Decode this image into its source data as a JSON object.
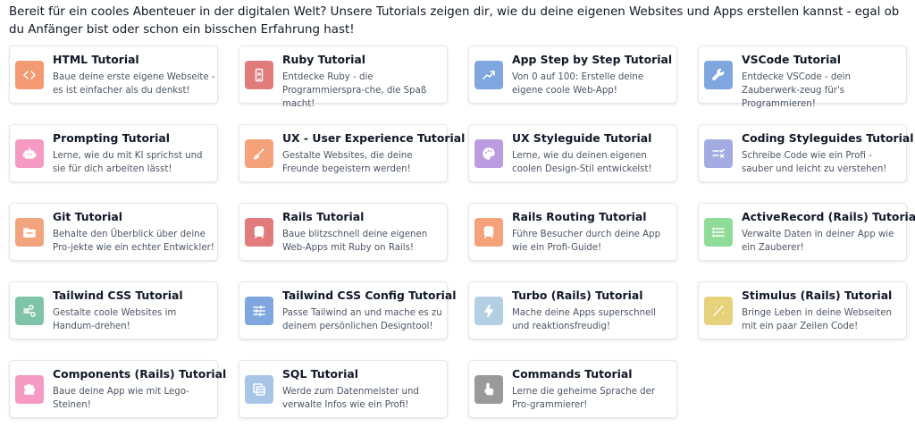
{
  "intro": "Bereit für ein cooles Abenteuer in der digitalen Welt? Unsere Tutorials zeigen dir, wie du deine eigenen Websites und Apps erstellen kannst - egal ob du Anfänger bist oder schon ein bisschen Erfahrung hast!",
  "cards": [
    {
      "title": "HTML Tutorial",
      "desc": "Baue deine erste eigene Webseite - es ist einfacher als du denkst!",
      "icon": "code-icon",
      "color": "#f39a72"
    },
    {
      "title": "Ruby Tutorial",
      "desc": "Entdecke Ruby - die Programmierspra-che, die Spaß macht!",
      "icon": "mobile-icon",
      "color": "#e27b7b"
    },
    {
      "title": "App Step by Step Tutorial",
      "desc": "Von 0 auf 100: Erstelle deine eigene coole Web-App!",
      "icon": "trending-up-icon",
      "color": "#7fa6de"
    },
    {
      "title": "VSCode Tutorial",
      "desc": "Entdecke VSCode - dein Zauberwerk-zeug für's Programmieren!",
      "icon": "wrench-icon",
      "color": "#7fa6de"
    },
    {
      "title": "Prompting Tutorial",
      "desc": "Lerne, wie du mit KI sprichst und sie für dich arbeiten lässt!",
      "icon": "robot-icon",
      "color": "#f59ac2"
    },
    {
      "title": "UX - User Experience Tutorial",
      "desc": "Gestalte Websites, die deine Freunde begeistern werden!",
      "icon": "brush-icon",
      "color": "#f5a27a"
    },
    {
      "title": "UX Styleguide Tutorial",
      "desc": "Lerne, wie du deinen eigenen coolen Design-Stil entwickelst!",
      "icon": "palette-icon",
      "color": "#bc9be0"
    },
    {
      "title": "Coding Styleguides Tutorial",
      "desc": "Schreibe Code wie ein Profi - sauber und leicht zu verstehen!",
      "icon": "list-check-icon",
      "color": "#a3ace2"
    },
    {
      "title": "Git Tutorial",
      "desc": "Behalte den Überblick über deine Pro-jekte wie ein echter Entwickler!",
      "icon": "folder-icon",
      "color": "#f2a47e"
    },
    {
      "title": "Rails Tutorial",
      "desc": "Baue blitzschnell deine eigenen Web-Apps mit Ruby on Rails!",
      "icon": "train-icon",
      "color": "#e27b7b"
    },
    {
      "title": "Rails Routing Tutorial",
      "desc": "Führe Besucher durch deine App wie ein Profi-Guide!",
      "icon": "train-icon",
      "color": "#f5a27a"
    },
    {
      "title": "ActiveRecord (Rails) Tutorial",
      "desc": "Verwalte Daten in deiner App wie ein Zauberer!",
      "icon": "list-icon",
      "color": "#8fdc98"
    },
    {
      "title": "Tailwind CSS Tutorial",
      "desc": "Gestalte coole Websites im Handum-drehen!",
      "icon": "wind-icon",
      "color": "#7fc4a8"
    },
    {
      "title": "Tailwind CSS Config Tutorial",
      "desc": "Passe Tailwind an und mache es zu deinem persönlichen Designtool!",
      "icon": "sliders-icon",
      "color": "#7fa6de"
    },
    {
      "title": "Turbo (Rails) Tutorial",
      "desc": "Mache deine Apps superschnell und reaktionsfreudig!",
      "icon": "bolt-icon",
      "color": "#b3d0e3"
    },
    {
      "title": "Stimulus (Rails) Tutorial",
      "desc": "Bringe Leben in deine Webseiten mit ein paar Zeilen Code!",
      "icon": "magic-wand-icon",
      "color": "#e6d27a"
    },
    {
      "title": "Components (Rails) Tutorial",
      "desc": "Baue deine App wie mit Lego-Steinen!",
      "icon": "puzzle-icon",
      "color": "#f59ac2"
    },
    {
      "title": "SQL Tutorial",
      "desc": "Werde zum Datenmeister und verwalte Infos wie ein Profi!",
      "icon": "layers-icon",
      "color": "#a8c5e8"
    },
    {
      "title": "Commands Tutorial",
      "desc": "Lerne die geheime Sprache der Pro-grammierer!",
      "icon": "pointer-icon",
      "color": "#9a9a9a"
    }
  ]
}
